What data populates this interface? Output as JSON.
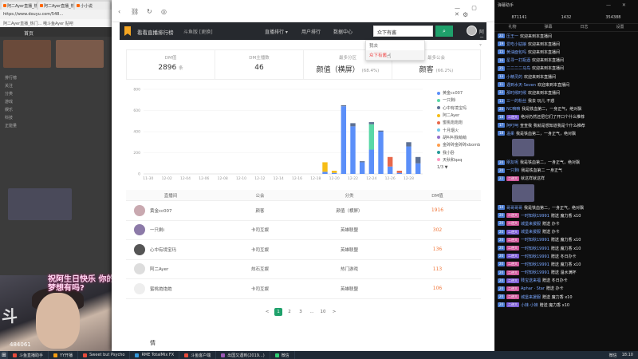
{
  "background": {
    "tabs": [
      "阿二Ayer直播_热门游戏直播",
      "阿二Ayer直播_热门游戏直",
      "小小说",
      "..."
    ],
    "address": "https://www.douyu.com/548...",
    "bookmarks": "阿二Ayer直播_热门... 哦斗鱼Ayer 贴吧",
    "site_nav": "首页",
    "side_menu": [
      "排行榜",
      "关注",
      "分类",
      "游戏",
      "娱乐",
      "科技",
      "正能量"
    ],
    "stream_banner": "祝阿生日快乐 你的过去梦想有吗?",
    "stream_count": "484061"
  },
  "window": {
    "controls": "— ▢ ✕"
  },
  "navbar": {
    "title": "看看直播排行榜",
    "site": "斗鱼版 [更换]",
    "menus": [
      "直播排行 ▾",
      "用户排行",
      "数据中心"
    ],
    "search_value": "众下有酱",
    "search_icon": "search-icon",
    "user": "阿二 ▾"
  },
  "suggest": {
    "items": [
      "我去",
      "众下有酱"
    ]
  },
  "stats": [
    {
      "label": "DM值",
      "value": "2896",
      "unit": "条"
    },
    {
      "label": "DM主播数",
      "value": "46",
      "unit": ""
    },
    {
      "label": "最多分区",
      "value": "颜值（横屏）",
      "unit": "(68.4%)"
    },
    {
      "label": "最多公会",
      "value": "颜客",
      "unit": "(66.2%)"
    }
  ],
  "chart_data": {
    "type": "bar",
    "stacked": true,
    "ylim": [
      0,
      800
    ],
    "yticks": [
      0,
      200,
      400,
      600,
      800
    ],
    "categories": [
      "11-30",
      "12-01",
      "12-02",
      "12-03",
      "12-04",
      "12-05",
      "12-06",
      "12-07",
      "12-08",
      "12-09",
      "12-10",
      "12-11",
      "12-12",
      "12-13",
      "12-14",
      "12-15",
      "12-16",
      "12-17",
      "12-18",
      "12-19",
      "12-20",
      "12-21",
      "12-22",
      "12-23",
      "12-24",
      "12-25",
      "12-26",
      "12-27",
      "12-28",
      "12-29"
    ],
    "xtick_labels": [
      "11-30",
      "12-02",
      "12-04",
      "12-06",
      "12-08",
      "12-10",
      "12-12",
      "12-14",
      "12-16",
      "12-18",
      "12-20",
      "12-22",
      "12-24",
      "12-26",
      "12-28"
    ],
    "series": [
      {
        "name": "黄金cc007",
        "color": "#5b8ff9",
        "values": [
          0,
          0,
          0,
          0,
          0,
          0,
          0,
          0,
          0,
          0,
          0,
          0,
          0,
          0,
          0,
          0,
          0,
          0,
          0,
          20,
          10,
          640,
          450,
          110,
          230,
          400,
          70,
          10,
          260,
          100
        ]
      },
      {
        "name": "一只剩i",
        "color": "#5ad8a6",
        "values": [
          0,
          0,
          0,
          0,
          0,
          0,
          0,
          0,
          0,
          0,
          0,
          0,
          0,
          0,
          0,
          0,
          0,
          0,
          0,
          0,
          0,
          0,
          0,
          0,
          240,
          0,
          0,
          0,
          0,
          0
        ]
      },
      {
        "name": "心中有境宝玛",
        "color": "#5d7092",
        "values": [
          0,
          0,
          0,
          0,
          0,
          0,
          0,
          0,
          0,
          0,
          0,
          0,
          0,
          0,
          0,
          0,
          0,
          0,
          0,
          0,
          0,
          10,
          30,
          10,
          20,
          10,
          0,
          0,
          40,
          60
        ]
      },
      {
        "name": "阿二Ayer",
        "color": "#f6bd16",
        "values": [
          0,
          0,
          0,
          0,
          0,
          0,
          0,
          0,
          0,
          0,
          0,
          0,
          0,
          0,
          0,
          0,
          0,
          0,
          0,
          90,
          20,
          0,
          0,
          0,
          0,
          0,
          0,
          0,
          0,
          0
        ]
      },
      {
        "name": "蜜桃炮炮炮",
        "color": "#e8684a",
        "values": [
          0,
          0,
          0,
          0,
          0,
          0,
          0,
          0,
          0,
          0,
          0,
          0,
          0,
          0,
          0,
          0,
          0,
          0,
          0,
          0,
          0,
          0,
          0,
          0,
          0,
          0,
          90,
          20,
          0,
          0
        ]
      },
      {
        "name": "十月烟火",
        "color": "#6dc8ec",
        "values": [
          0,
          0,
          0,
          0,
          0,
          0,
          0,
          0,
          0,
          0,
          0,
          0,
          0,
          0,
          0,
          0,
          0,
          0,
          0,
          0,
          0,
          0,
          0,
          0,
          0,
          0,
          0,
          0,
          0,
          0
        ]
      },
      {
        "name": "胡叫叫我萌萌",
        "color": "#9270ca",
        "values": [
          0,
          0,
          0,
          0,
          0,
          0,
          0,
          0,
          0,
          0,
          0,
          0,
          0,
          0,
          0,
          0,
          0,
          0,
          0,
          0,
          0,
          0,
          0,
          0,
          0,
          0,
          0,
          0,
          0,
          0
        ]
      },
      {
        "name": "金砖砖金砖砖xbomb",
        "color": "#ff9d4d",
        "values": [
          0,
          0,
          0,
          0,
          0,
          0,
          0,
          0,
          0,
          0,
          0,
          0,
          0,
          0,
          0,
          0,
          0,
          0,
          0,
          0,
          0,
          0,
          0,
          0,
          0,
          0,
          0,
          0,
          0,
          0
        ]
      },
      {
        "name": "我小卧",
        "color": "#269a99",
        "values": [
          0,
          0,
          0,
          0,
          0,
          0,
          0,
          0,
          0,
          0,
          0,
          0,
          0,
          0,
          0,
          0,
          0,
          0,
          0,
          0,
          0,
          0,
          0,
          0,
          0,
          0,
          0,
          0,
          0,
          0
        ]
      },
      {
        "name": "天秋和qaq",
        "color": "#ff99c3",
        "values": [
          0,
          0,
          0,
          0,
          0,
          0,
          0,
          0,
          0,
          0,
          0,
          0,
          0,
          0,
          0,
          0,
          0,
          0,
          0,
          0,
          0,
          0,
          0,
          0,
          0,
          0,
          0,
          0,
          0,
          0
        ]
      }
    ],
    "legend_position": "right",
    "legend_pager": "1/3 ▼"
  },
  "table": {
    "headers": [
      "直播间",
      "公会",
      "分类",
      "DM值"
    ],
    "rows": [
      {
        "name": "黄金cc007",
        "guild": "颜客",
        "category": "颜值（横屏）",
        "dm": "1916",
        "avatar": "#c9a9b0"
      },
      {
        "name": "一只剩i",
        "guild": "卡司互娱",
        "category": "英雄联盟",
        "dm": "302",
        "avatar": "#8c7aa8"
      },
      {
        "name": "心中有境宝玛",
        "guild": "卡司互娱",
        "category": "英雄联盟",
        "dm": "136",
        "avatar": "#555555"
      },
      {
        "name": "阿二Ayer",
        "guild": "炫石互娱",
        "category": "热门游戏",
        "dm": "113",
        "avatar": "#dddddd"
      },
      {
        "name": "蜜桃炮炮炮",
        "guild": "卡司互娱",
        "category": "英雄联盟",
        "dm": "106",
        "avatar": "#eeeeee"
      }
    ]
  },
  "pager": [
    "<",
    "1",
    "2",
    "3",
    "...",
    "10",
    ">"
  ],
  "footer_label": "情",
  "right_panel": {
    "title": "弹幕助手",
    "stats": [
      "871141",
      "1432",
      "354388"
    ],
    "tabs": [
      "礼物",
      "弹幕",
      "日志",
      "设置"
    ],
    "chat": [
      {
        "lv": "22",
        "badge": "",
        "name": "压王一",
        "text": "欢迎来到本直播间"
      },
      {
        "lv": "19",
        "badge": "",
        "name": "爱吃小姑娘",
        "text": "欢迎来到本直播间"
      },
      {
        "lv": "15",
        "badge": "",
        "name": "黄油面包吗",
        "text": "欢迎来到本直播间"
      },
      {
        "lv": "16",
        "badge": "",
        "name": "星寻一打瓶酒",
        "text": "欢迎来到本直播间"
      },
      {
        "lv": "25",
        "badge": "",
        "name": "二二二二马鸟",
        "text": "欢迎来到本直播间"
      },
      {
        "lv": "13",
        "badge": "",
        "name": "小精灵的",
        "text": "欢迎来到本直播间"
      },
      {
        "lv": "11",
        "badge": "",
        "name": "遇到水天·Seven",
        "text": "欢迎来到本直播间"
      },
      {
        "lv": "22",
        "badge": "",
        "name": "那时候时候",
        "text": "欢迎来到本直播间"
      },
      {
        "lv": "13",
        "badge": "",
        "name": "三一的粉丝",
        "text": "我去 玩儿 不惑"
      },
      {
        "lv": "20",
        "badge": "",
        "name": "NC嘛嘛",
        "text": "我是铁血第二，一身正气，绝对飘"
      },
      {
        "lv": "18",
        "badge": "二逆大",
        "name": "",
        "text": "绝对仍然还把它们了开口个什么推荐"
      },
      {
        "lv": "17",
        "badge": "",
        "name": "阿叮呵",
        "text": "查查我 我就是想知道我是个什么推荐"
      },
      {
        "lv": "18",
        "badge": "",
        "name": "温柔",
        "text": "我是铁血第二，一身正气，绝对飘"
      },
      {
        "lv": "20",
        "badge": "",
        "name": "朋友呢",
        "text": "我是铁血第二，一身正气，绝对飘"
      },
      {
        "lv": "20",
        "badge": "",
        "name": "一只剩i",
        "text": "我是铁血第二 一身正气"
      },
      {
        "lv": "22",
        "badge": "二逆大",
        "name": "",
        "text": "就这样就这样"
      },
      {
        "lv": "14",
        "badge": "",
        "name": "哥哥哥哥",
        "text": "我是铁血第二，一身正气，绝对飘"
      },
      {
        "lv": "20",
        "badge": "二逆大",
        "name": "一时知秋19991",
        "text": "赠送 魔力香 x10"
      },
      {
        "lv": "20",
        "badge": "二逆大",
        "name": "城堡来援服",
        "text": "赠送 办卡"
      },
      {
        "lv": "20",
        "badge": "二逆大",
        "name": "城堡来援服",
        "text": "赠送 办卡"
      },
      {
        "lv": "20",
        "badge": "二逆大",
        "name": "一时知秋19991",
        "text": "赠送 魔力香 x10"
      },
      {
        "lv": "20",
        "badge": "二逆大",
        "name": "一时知秋19991",
        "text": "赠送 魔力香 x10"
      },
      {
        "lv": "20",
        "badge": "二逆大",
        "name": "一时知秋19991",
        "text": "赠送 冬日办卡"
      },
      {
        "lv": "20",
        "badge": "二逆大",
        "name": "一时知秋19991",
        "text": "赠送 魔力香 x10"
      },
      {
        "lv": "20",
        "badge": "二逆大",
        "name": "一时知秋19991",
        "text": "赠送 温水满杯"
      },
      {
        "lv": "20",
        "badge": "二逆大",
        "name": "贱宝送来福",
        "text": "赠送 冬日办卡"
      },
      {
        "lv": "20",
        "badge": "二逆大",
        "name": "Aphar · Star",
        "text": "赠送 办卡"
      },
      {
        "lv": "20",
        "badge": "二逆大",
        "name": "城堡来援服",
        "text": "赠送 魔力香 x10"
      },
      {
        "lv": "20",
        "badge": "二逆大",
        "name": "小妹·小妹",
        "text": "赠送 魔力香 x10"
      }
    ]
  },
  "taskbar": {
    "start": "⊞",
    "items": [
      "斗鱼直播助手",
      "YY开播",
      "Sweet but Psycho",
      "RME TotalMix FX",
      "斗鱼客户端",
      "出国又遇到(2019...)",
      "微信"
    ],
    "tray": [
      "微信",
      "18:10"
    ]
  }
}
